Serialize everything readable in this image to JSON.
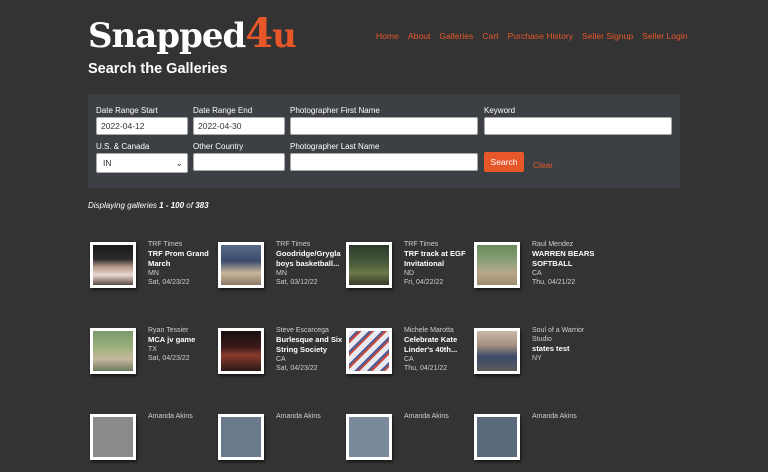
{
  "brand": {
    "name_part1": "Snapped",
    "name_part2": "4",
    "name_part3": "u"
  },
  "nav": [
    "Home",
    "About",
    "Galleries",
    "Cart",
    "Purchase History",
    "Seller Signup",
    "Seller Login"
  ],
  "page_title": "Search the Galleries",
  "form": {
    "date_start_label": "Date Range Start",
    "date_start_value": "2022-04-12",
    "date_end_label": "Date Range End",
    "date_end_value": "2022-04-30",
    "first_name_label": "Photographer First Name",
    "first_name_value": "",
    "keyword_label": "Keyword",
    "keyword_value": "",
    "country_label": "U.S. & Canada",
    "country_value": "IN",
    "other_country_label": "Other Country",
    "other_country_value": "",
    "last_name_label": "Photographer Last Name",
    "last_name_value": "",
    "search_label": "Search",
    "clear_label": "Clear"
  },
  "summary": {
    "prefix": "Displaying galleries",
    "range": "1 - 100",
    "of": "of",
    "total": "383"
  },
  "galleries": [
    {
      "photographer": "TRF Times",
      "title_l1": "TRF Prom Grand",
      "title_l2": "March",
      "state": "MN",
      "date": "Sat, 04/23/22"
    },
    {
      "photographer": "TRF Times",
      "title_l1": "Goodridge/Grygla",
      "title_l2": "boys basketball...",
      "state": "MN",
      "date": "Sat, 03/12/22"
    },
    {
      "photographer": "TRF Times",
      "title_l1": "TRF track at EGF",
      "title_l2": "Invitational",
      "state": "ND",
      "date": "Fri, 04/22/22"
    },
    {
      "photographer": "Raul Mendez",
      "title_l1": "WARREN BEARS",
      "title_l2": "SOFTBALL",
      "state": "CA",
      "date": "Thu, 04/21/22"
    },
    {
      "photographer": "Ryan Tessier",
      "title_l1": "MCA jv game",
      "title_l2": "",
      "state": "TX",
      "date": "Sat, 04/23/22"
    },
    {
      "photographer": "Steve Escarcega",
      "title_l1": "Burlesque and Six",
      "title_l2": "String Society",
      "state": "CA",
      "date": "Sat, 04/23/22"
    },
    {
      "photographer": "Michele Marotta",
      "title_l1": "Celebrate Kate",
      "title_l2": "Linder's 40th...",
      "state": "CA",
      "date": "Thu, 04/21/22"
    },
    {
      "photographer": "Soul of a Warrior",
      "photographer_l2": "Studio",
      "title_l1": "states test",
      "title_l2": "",
      "state": "NY",
      "date": ""
    },
    {
      "photographer": "Amanda Akins",
      "title_l1": "",
      "title_l2": "",
      "state": "",
      "date": ""
    },
    {
      "photographer": "Amanda Akins",
      "title_l1": "",
      "title_l2": "",
      "state": "",
      "date": ""
    },
    {
      "photographer": "Amanda Akins",
      "title_l1": "",
      "title_l2": "",
      "state": "",
      "date": ""
    },
    {
      "photographer": "Amanda Akins",
      "title_l1": "",
      "title_l2": "",
      "state": "",
      "date": ""
    }
  ],
  "colors": {
    "accent": "#e8572a",
    "background": "#333333",
    "panel": "#3c3f44"
  }
}
